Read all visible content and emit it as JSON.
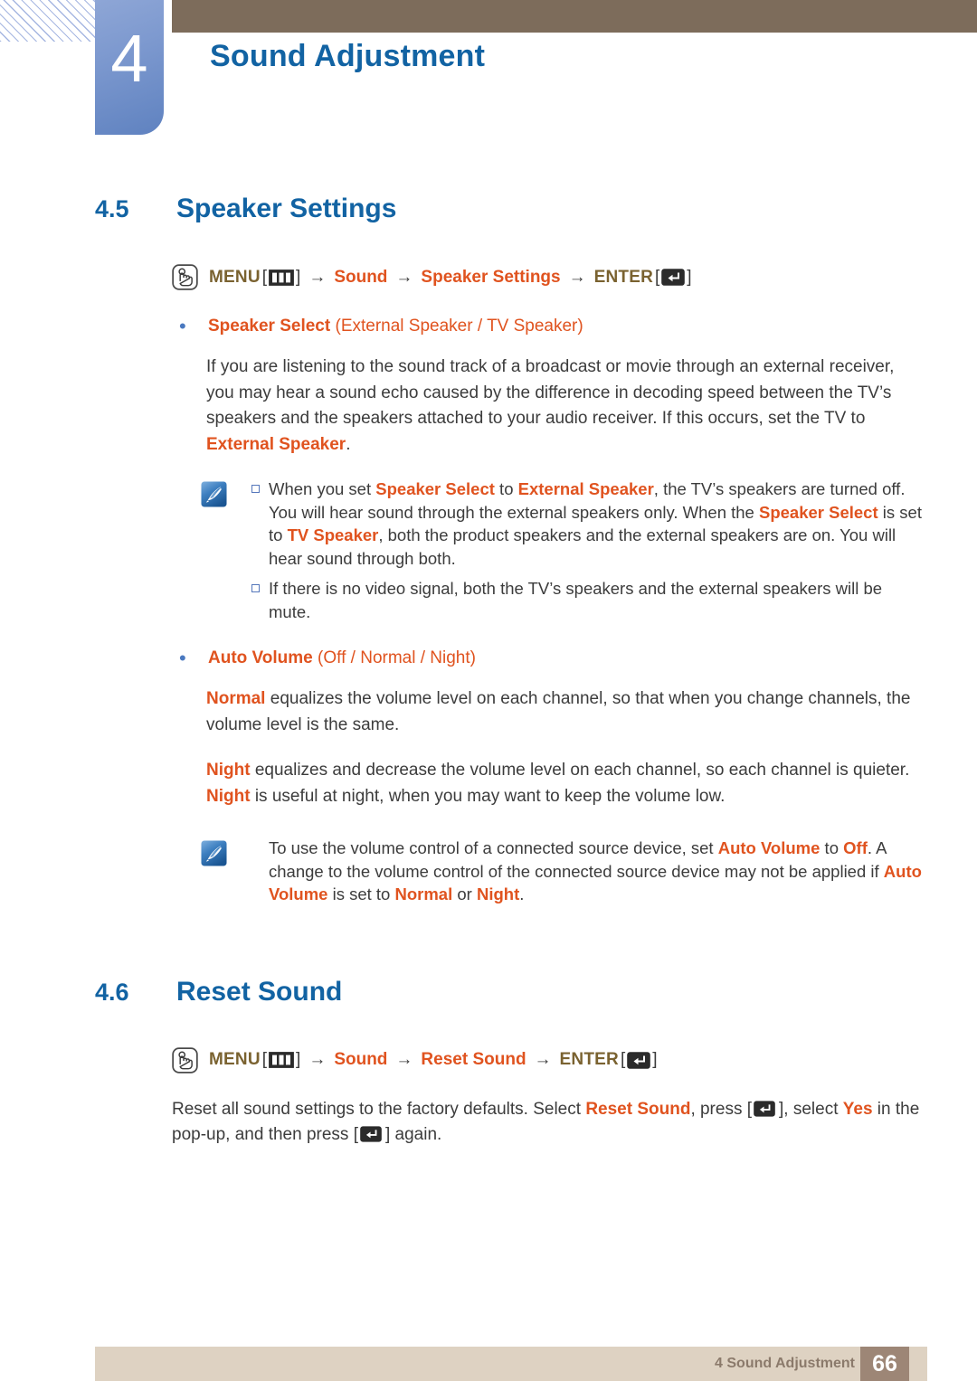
{
  "header": {
    "chapter_number": "4",
    "chapter_title": "Sound Adjustment"
  },
  "sections": {
    "speaker_settings": {
      "number": "4.5",
      "title": "Speaker Settings",
      "menu_path": {
        "hand_icon": "hand-touch-icon",
        "menu_label": "MENU",
        "menu_icon": "menu-bars-icon",
        "bracket_open": "[",
        "bracket_close": "]",
        "arrow": "→",
        "step1": "Sound",
        "step2": "Speaker Settings",
        "enter_label": "ENTER",
        "enter_icon": "enter-key-icon"
      },
      "bullet1": {
        "bold": "Speaker Select",
        "paren_open": " (",
        "opt1": "External Speaker",
        "sep": " / ",
        "opt2": "TV Speaker",
        "paren_close": ")"
      },
      "para1_a": "If you are listening to the sound track of a broadcast or movie through an external receiver, you may hear a sound echo caused by the difference in decoding speed between the TV’s speakers and the speakers attached to your audio receiver. If this occurs, set the TV to ",
      "para1_kw": "External Speaker",
      "para1_b": ".",
      "note1": {
        "icon": "note-pencil-icon",
        "item1": {
          "t1": "When you set ",
          "k1": "Speaker Select",
          "t2": " to ",
          "k2": "External Speaker",
          "t3": ", the TV’s speakers are turned off. You will hear sound through the external speakers only. When the ",
          "k3": "Speaker Select",
          "t4": " is set to ",
          "k4": "TV Speaker",
          "t5": ", both the product speakers and the external speakers are on. You will hear sound through both."
        },
        "item2": {
          "t1": "If there is no video signal, both the TV’s speakers and the external speakers will be mute."
        }
      },
      "bullet2": {
        "bold": "Auto Volume",
        "paren_open": " (",
        "opt1": "Off",
        "sep1": " / ",
        "opt2": "Normal",
        "sep2": " / ",
        "opt3": "Night",
        "paren_close": ")"
      },
      "para2_kw": "Normal",
      "para2_text": " equalizes the volume level on each channel, so that when you change channels, the volume level is the same.",
      "para3_kw1": "Night",
      "para3_text1": " equalizes and decrease the volume level on each channel, so each channel is quieter. ",
      "para3_kw2": "Night",
      "para3_text2": " is useful at night, when you may want to keep the volume low.",
      "note2": {
        "icon": "note-pencil-icon",
        "t1": "To use the volume control of a connected source device, set ",
        "k1": "Auto Volume",
        "t2": " to ",
        "k2": "Off",
        "t3": ". A change to the volume control of the connected source device may not be applied if ",
        "k3": "Auto Volume",
        "t4": " is set to ",
        "k4": "Normal",
        "t5": " or ",
        "k5": "Night",
        "t6": "."
      }
    },
    "reset_sound": {
      "number": "4.6",
      "title": "Reset Sound",
      "menu_path": {
        "hand_icon": "hand-touch-icon",
        "menu_label": "MENU",
        "menu_icon": "menu-bars-icon",
        "bracket_open": "[",
        "bracket_close": "]",
        "arrow": "→",
        "step1": "Sound",
        "step2": "Reset Sound",
        "enter_label": "ENTER",
        "enter_icon": "enter-key-icon"
      },
      "para": {
        "t1": "Reset all sound settings to the factory defaults. Select ",
        "k1": "Reset Sound",
        "t2": ", press [",
        "icon1": "enter-key-icon",
        "t3": "], select ",
        "k2": "Yes",
        "t4": " in the pop-up, and then press [",
        "icon2": "enter-key-icon",
        "t5": "] again."
      }
    }
  },
  "footer": {
    "label": "4 Sound Adjustment",
    "page_number": "66"
  },
  "colors": {
    "heading_blue": "#1263a3",
    "keyword_orange": "#e0531f",
    "menu_brown": "#7a6230",
    "header_bar": "#7d6c5b",
    "footer_bar": "#ded2c2",
    "page_box": "#9d8676",
    "badge_blue": "#5f82c0"
  }
}
